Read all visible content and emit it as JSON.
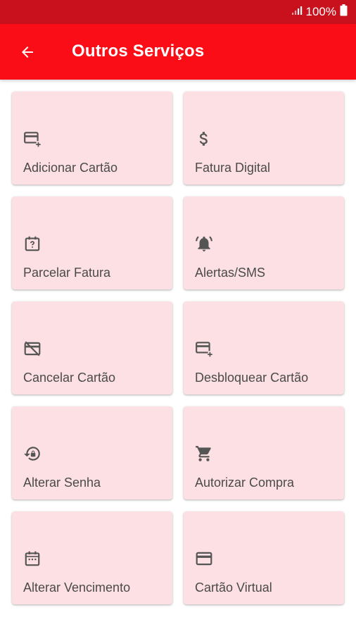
{
  "status_bar": {
    "battery": "100%"
  },
  "header": {
    "title": "Outros Serviços",
    "back_icon": "arrow-back-icon"
  },
  "colors": {
    "status_bar": "#c8111d",
    "app_bar": "#fb0d18",
    "tile_bg": "#fde0e3",
    "icon": "#555555"
  },
  "services": [
    {
      "label": "Adicionar Cartão",
      "icon": "add-card-icon"
    },
    {
      "label": "Fatura Digital",
      "icon": "dollar-icon"
    },
    {
      "label": "Parcelar Fatura",
      "icon": "calendar-question-icon"
    },
    {
      "label": "Alertas/SMS",
      "icon": "alarm-bell-icon"
    },
    {
      "label": "Cancelar Cartão",
      "icon": "card-off-icon"
    },
    {
      "label": "Desbloquear Cartão",
      "icon": "add-card-icon"
    },
    {
      "label": "Alterar Senha",
      "icon": "lock-reset-icon"
    },
    {
      "label": "Autorizar Compra",
      "icon": "cart-icon"
    },
    {
      "label": "Alterar Vencimento",
      "icon": "calendar-icon"
    },
    {
      "label": "Cartão Virtual",
      "icon": "credit-card-icon"
    }
  ]
}
